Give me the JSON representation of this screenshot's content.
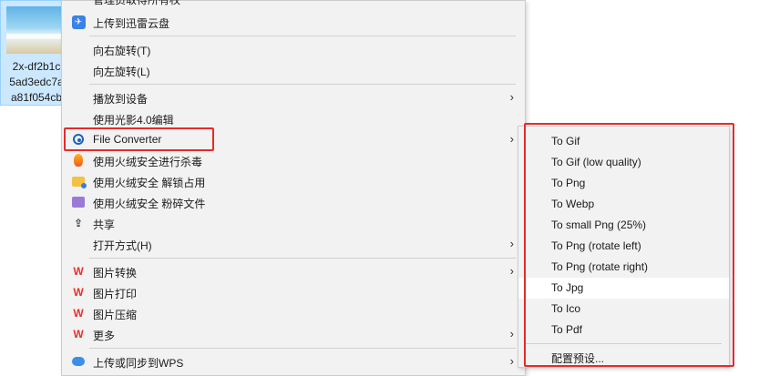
{
  "desktop_file": {
    "name_lines": [
      "2x-df2b1c",
      "5ad3edc7a",
      "a81f054cb"
    ]
  },
  "context_menu": {
    "top_cut_label": "管理员取得所有权",
    "items": [
      {
        "label": "上传到迅雷云盘",
        "icon": "thunder-cloud-icon"
      },
      {
        "label": "向右旋转(T)"
      },
      {
        "label": "向左旋转(L)"
      },
      {
        "label": "播放到设备",
        "submenu": true
      },
      {
        "label": "使用光影4.0编辑"
      },
      {
        "label": "File Converter",
        "icon": "file-converter-icon",
        "submenu": true
      },
      {
        "label": "使用火绒安全进行杀毒",
        "icon": "huorong-flame-icon"
      },
      {
        "label": "使用火绒安全 解锁占用",
        "icon": "unlock-folder-icon"
      },
      {
        "label": "使用火绒安全 粉碎文件",
        "icon": "shredder-icon"
      },
      {
        "label": "共享",
        "icon": "share-icon"
      },
      {
        "label": "打开方式(H)",
        "submenu": true
      },
      {
        "label": "图片转换",
        "icon": "wps-icon",
        "submenu": true
      },
      {
        "label": "图片打印",
        "icon": "wps-icon"
      },
      {
        "label": "图片压缩",
        "icon": "wps-icon"
      },
      {
        "label": "更多",
        "icon": "wps-icon",
        "submenu": true
      },
      {
        "label": "上传或同步到WPS",
        "icon": "wps-cloud-icon",
        "submenu": true
      }
    ],
    "submenu_arrow": "›",
    "wps_glyph": "W",
    "share_glyph": "⇪"
  },
  "file_converter_submenu": {
    "items": [
      {
        "label": "To Gif"
      },
      {
        "label": "To Gif (low quality)"
      },
      {
        "label": "To Png"
      },
      {
        "label": "To Webp"
      },
      {
        "label": "To small Png (25%)"
      },
      {
        "label": "To Png (rotate left)"
      },
      {
        "label": "To Png (rotate right)"
      },
      {
        "label": "To Jpg",
        "highlighted": true
      },
      {
        "label": "To Ico"
      },
      {
        "label": "To Pdf"
      }
    ],
    "configure_label": "配置预设..."
  },
  "colors": {
    "highlight_box": "#e52b2b",
    "menu_bg": "#f2f2f2",
    "selection_bg": "#cce8ff"
  }
}
